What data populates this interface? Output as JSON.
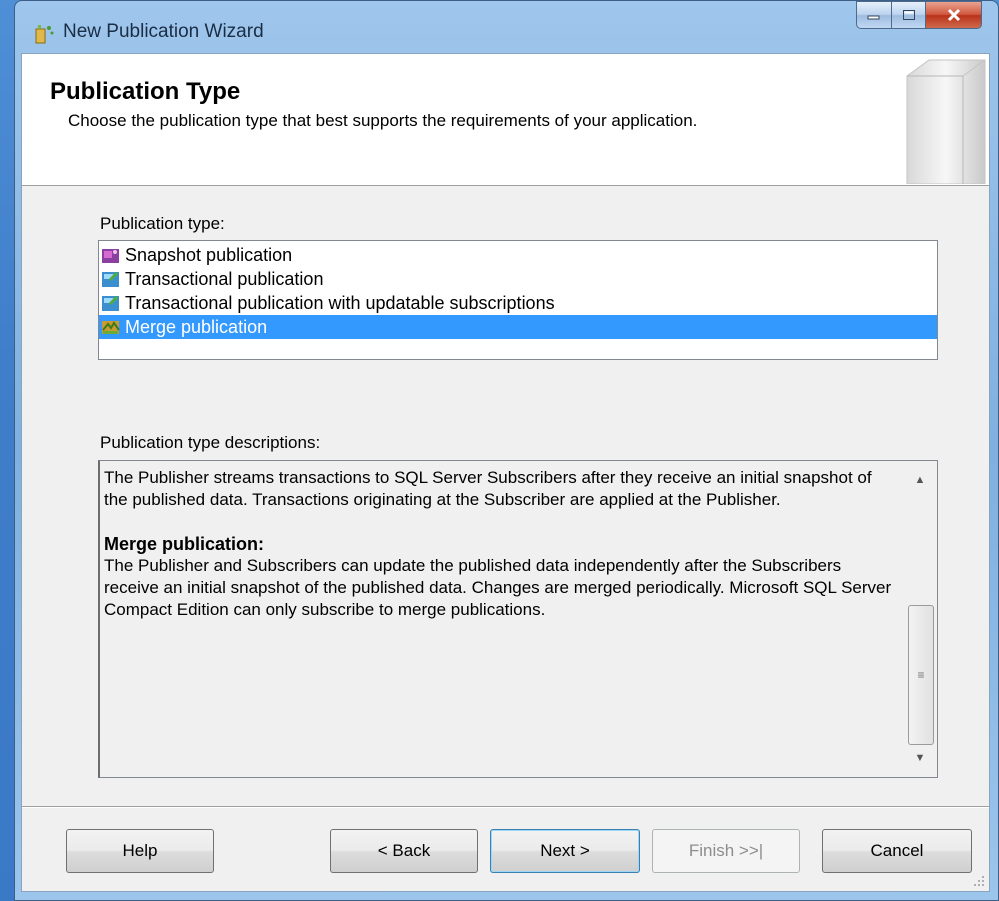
{
  "window": {
    "title": "New Publication Wizard"
  },
  "header": {
    "title": "Publication Type",
    "description": "Choose the publication type that best supports the requirements of your application."
  },
  "publication_type": {
    "label": "Publication type:",
    "items": [
      {
        "label": "Snapshot publication",
        "icon": "snapshot-publication-icon"
      },
      {
        "label": "Transactional publication",
        "icon": "transactional-publication-icon"
      },
      {
        "label": "Transactional publication with updatable subscriptions",
        "icon": "transactional-updatable-icon"
      },
      {
        "label": "Merge publication",
        "icon": "merge-publication-icon",
        "selected": true
      }
    ]
  },
  "descriptions": {
    "label": "Publication type descriptions:",
    "paragraph1": "The Publisher streams transactions to SQL Server Subscribers after they receive an initial snapshot of the published data. Transactions originating at the Subscriber are applied at the Publisher.",
    "heading": "Merge publication:",
    "paragraph2": "The Publisher and Subscribers can update the published data independently after the Subscribers receive an initial snapshot of the published data. Changes are merged periodically. Microsoft SQL Server Compact Edition can only subscribe to merge publications."
  },
  "buttons": {
    "help": "Help",
    "back": "< Back",
    "next": "Next >",
    "finish": "Finish >>|",
    "cancel": "Cancel"
  },
  "colors": {
    "selection": "#3399ff",
    "desktop": "#3f7ec9"
  }
}
